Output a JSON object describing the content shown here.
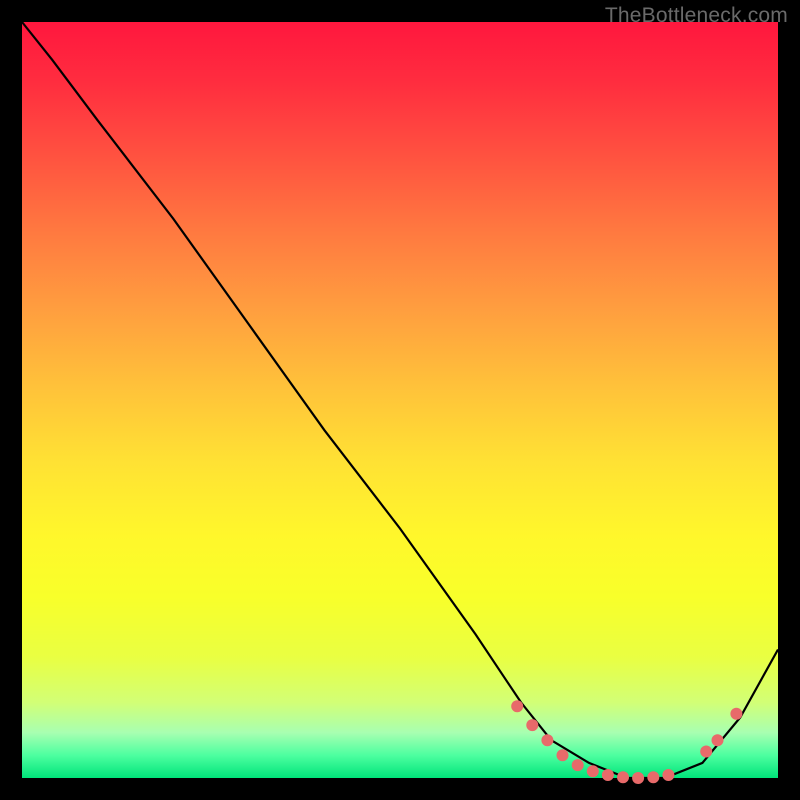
{
  "watermark": "TheBottleneck.com",
  "chart_data": {
    "type": "line",
    "title": "",
    "xlabel": "",
    "ylabel": "",
    "xlim": [
      0,
      1
    ],
    "ylim": [
      0,
      1
    ],
    "series": [
      {
        "name": "bottleneck-curve",
        "x": [
          0.0,
          0.04,
          0.1,
          0.2,
          0.3,
          0.4,
          0.5,
          0.6,
          0.66,
          0.7,
          0.75,
          0.8,
          0.85,
          0.9,
          0.95,
          1.0
        ],
        "y": [
          1.0,
          0.95,
          0.87,
          0.74,
          0.6,
          0.46,
          0.33,
          0.19,
          0.1,
          0.05,
          0.02,
          0.0,
          0.0,
          0.02,
          0.08,
          0.17
        ]
      }
    ],
    "markers": {
      "name": "optimal-range",
      "color": "#e86a6a",
      "points": [
        {
          "x": 0.655,
          "y": 0.095
        },
        {
          "x": 0.675,
          "y": 0.07
        },
        {
          "x": 0.695,
          "y": 0.05
        },
        {
          "x": 0.715,
          "y": 0.03
        },
        {
          "x": 0.735,
          "y": 0.017
        },
        {
          "x": 0.755,
          "y": 0.009
        },
        {
          "x": 0.775,
          "y": 0.004
        },
        {
          "x": 0.795,
          "y": 0.001
        },
        {
          "x": 0.815,
          "y": 0.0
        },
        {
          "x": 0.835,
          "y": 0.001
        },
        {
          "x": 0.855,
          "y": 0.004
        },
        {
          "x": 0.905,
          "y": 0.035
        },
        {
          "x": 0.92,
          "y": 0.05
        },
        {
          "x": 0.945,
          "y": 0.085
        }
      ]
    }
  }
}
